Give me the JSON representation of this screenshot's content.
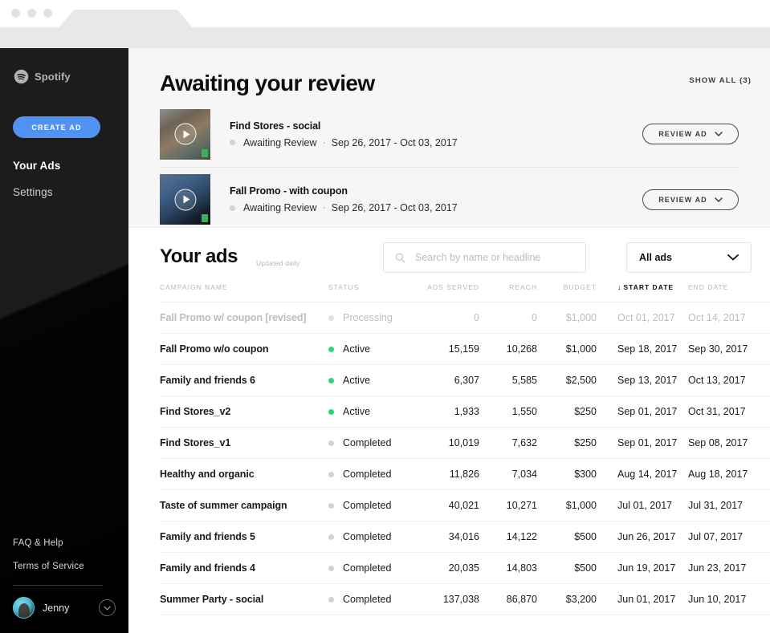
{
  "browser": {
    "dots": [
      "dot-1",
      "dot-2",
      "dot-3"
    ]
  },
  "sidebar": {
    "brand": "Spotify",
    "create_ad_label": "CREATE AD",
    "nav": [
      {
        "label": "Your Ads",
        "active": true
      },
      {
        "label": "Settings",
        "active": false
      }
    ],
    "footer_links": [
      "FAQ & Help",
      "Terms of Service"
    ],
    "user": {
      "name": "Jenny"
    },
    "accent_blue": "#5093f5"
  },
  "review": {
    "title": "Awaiting your review",
    "show_all": "SHOW ALL (3)",
    "items": [
      {
        "name": "Find Stores - social",
        "status": "Awaiting Review",
        "separator": "·",
        "dates": "Sep 26, 2017 - Oct 03, 2017",
        "button": "REVIEW AD"
      },
      {
        "name": "Fall Promo - with coupon",
        "status": "Awaiting Review",
        "separator": "·",
        "dates": "Sep 26, 2017 - Oct 03, 2017",
        "button": "REVIEW AD"
      }
    ]
  },
  "ads": {
    "title": "Your ads",
    "updated": "Updated daily",
    "search_placeholder": "Search by name or headline",
    "search_value": "",
    "filter_selected": "All ads",
    "filter_options": [
      "All ads"
    ],
    "columns": [
      {
        "key": "name",
        "label": "CAMPAIGN NAME",
        "sorted": false
      },
      {
        "key": "status",
        "label": "STATUS",
        "sorted": false
      },
      {
        "key": "served",
        "label": "ADS SERVED",
        "sorted": false
      },
      {
        "key": "reach",
        "label": "REACH",
        "sorted": false
      },
      {
        "key": "budget",
        "label": "BUDGET",
        "sorted": false
      },
      {
        "key": "start",
        "label": "START DATE",
        "sorted": true,
        "sort_arrow": "↓"
      },
      {
        "key": "end",
        "label": "END DATE",
        "sorted": false
      }
    ],
    "status_colors": {
      "Active": "#2bd96a",
      "Completed": "#d2d2d2",
      "Processing": "#e0e0e0"
    },
    "row_more_glyph": "•••",
    "rows": [
      {
        "name": "Fall Promo w/ coupon [revised]",
        "status": "Processing",
        "served": "0",
        "reach": "0",
        "budget": "$1,000",
        "start": "Oct 01, 2017",
        "end": "Oct 14, 2017",
        "muted": true
      },
      {
        "name": "Fall Promo w/o coupon",
        "status": "Active",
        "served": "15,159",
        "reach": "10,268",
        "budget": "$1,000",
        "start": "Sep 18, 2017",
        "end": "Sep 30, 2017",
        "muted": false
      },
      {
        "name": "Family and friends 6",
        "status": "Active",
        "served": "6,307",
        "reach": "5,585",
        "budget": "$2,500",
        "start": "Sep 13, 2017",
        "end": "Oct 13, 2017",
        "muted": false
      },
      {
        "name": "Find Stores_v2",
        "status": "Active",
        "served": "1,933",
        "reach": "1,550",
        "budget": "$250",
        "start": "Sep 01, 2017",
        "end": "Oct 31, 2017",
        "muted": false
      },
      {
        "name": "Find Stores_v1",
        "status": "Completed",
        "served": "10,019",
        "reach": "7,632",
        "budget": "$250",
        "start": "Sep 01, 2017",
        "end": "Sep 08, 2017",
        "muted": false
      },
      {
        "name": "Healthy and organic",
        "status": "Completed",
        "served": "11,826",
        "reach": "7,034",
        "budget": "$300",
        "start": "Aug 14, 2017",
        "end": "Aug 18, 2017",
        "muted": false
      },
      {
        "name": "Taste of summer campaign",
        "status": "Completed",
        "served": "40,021",
        "reach": "10,271",
        "budget": "$1,000",
        "start": "Jul 01, 2017",
        "end": "Jul 31, 2017",
        "muted": false
      },
      {
        "name": "Family and friends 5",
        "status": "Completed",
        "served": "34,016",
        "reach": "14,122",
        "budget": "$500",
        "start": "Jun 26, 2017",
        "end": "Jul 07, 2017",
        "muted": false
      },
      {
        "name": "Family and friends 4",
        "status": "Completed",
        "served": "20,035",
        "reach": "14,803",
        "budget": "$500",
        "start": "Jun 19, 2017",
        "end": "Jun 23, 2017",
        "muted": false
      },
      {
        "name": "Summer Party - social",
        "status": "Completed",
        "served": "137,038",
        "reach": "86,870",
        "budget": "$3,200",
        "start": "Jun 01, 2017",
        "end": "Jun 10, 2017",
        "muted": false
      }
    ]
  }
}
